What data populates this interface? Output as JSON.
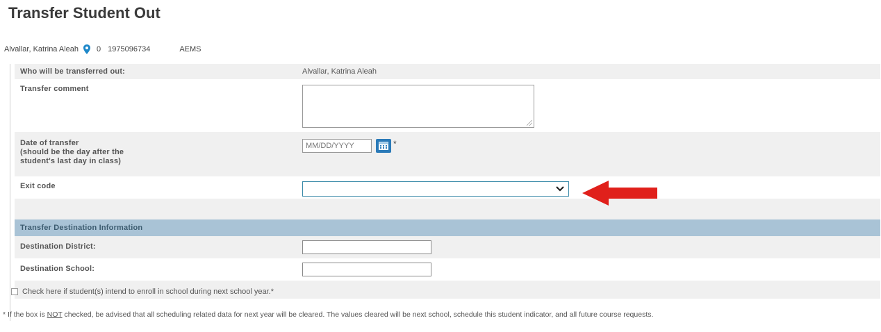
{
  "page": {
    "title": "Transfer Student Out"
  },
  "student": {
    "name": "Alvallar, Katrina Aleah",
    "grade": "0",
    "id": "1975096734",
    "school": "AEMS"
  },
  "form": {
    "who_label": "Who will be transferred out:",
    "who_value": "Alvallar, Katrina Aleah",
    "comment_label": "Transfer comment",
    "comment_value": "",
    "date_label_line1": "Date of transfer",
    "date_label_line2": "(should be the day after the",
    "date_label_line3": "student's last day in class)",
    "date_placeholder": "MM/DD/YYYY",
    "required_mark": "*",
    "exit_label": "Exit code",
    "exit_value": ""
  },
  "destination": {
    "section_title": "Transfer Destination Information",
    "district_label": "Destination District:",
    "district_value": "",
    "school_label": "Destination School:",
    "school_value": ""
  },
  "enroll_checkbox": {
    "label": "Check here if student(s) intend to enroll in school during next school year.*",
    "checked": false
  },
  "footnote": {
    "prefix": "* If the box is ",
    "emphasis": "NOT",
    "suffix": " checked, be advised that all scheduling related data for next year will be cleared. The values cleared will be next school, schedule this student indicator, and all future course requests."
  },
  "colors": {
    "section_header_bg": "#a9c3d6",
    "calendar_button": "#2a7ab8",
    "annotation_arrow": "#e0201b"
  },
  "icons": {
    "location": "location-pin-icon",
    "calendar": "calendar-icon",
    "dropdown": "chevron-down-icon",
    "arrow": "red-arrow-annotation"
  }
}
